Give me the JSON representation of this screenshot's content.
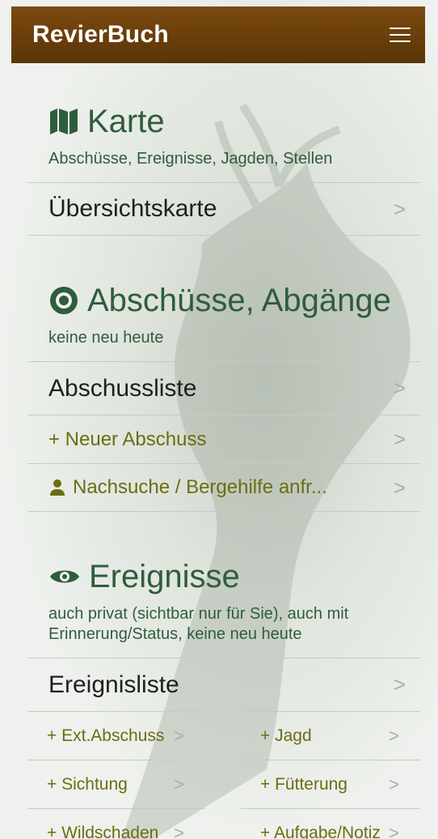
{
  "header": {
    "title": "RevierBuch",
    "menu_icon": "menu-icon"
  },
  "sections": {
    "karte": {
      "title": "Karte",
      "subtitle": "Abschüsse, Ereignisse, Jagden, Stellen",
      "items": {
        "overview": "Übersichtskarte"
      }
    },
    "abschuesse": {
      "title": "Abschüsse, Abgänge",
      "subtitle": "keine neu heute",
      "items": {
        "list": "Abschussliste",
        "new": "+ Neuer Abschuss",
        "request": "Nachsuche / Bergehilfe anfr..."
      }
    },
    "ereignisse": {
      "title": "Ereignisse",
      "subtitle": "auch privat (sichtbar nur für Sie), auch mit Erinnerung/Status, keine neu heute",
      "items": {
        "list": "Ereignisliste",
        "ext": "+ Ext.Abschuss",
        "jagd": "+ Jagd",
        "sichtung": "+ Sichtung",
        "fuetterung": "+ Fütterung",
        "wildschaden": "+ Wildschaden",
        "aufgabe": "+ Aufgabe/Notiz"
      }
    }
  },
  "colors": {
    "header_bg": "#6a3e0b",
    "section_green": "#2f5d3c",
    "action_olive": "#6c6d10",
    "chevron_gray": "#a9aeab"
  },
  "icons": {
    "karte": "map-icon",
    "abschuesse": "target-icon",
    "ereignisse": "eye-icon",
    "person": "person-icon",
    "chevron": "chevron-right-icon"
  }
}
